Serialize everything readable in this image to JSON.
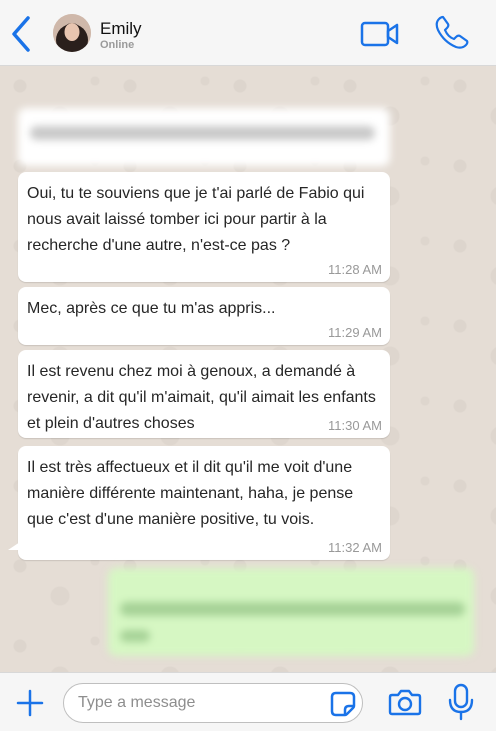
{
  "header": {
    "contact_name": "Emily",
    "status": "Online"
  },
  "messages": [
    {
      "text": "Oui, tu te souviens que je t'ai parlé de Fabio qui nous avait laissé tomber ici pour partir à la recherche d'une autre, n'est-ce pas ?",
      "time": "11:28 AM"
    },
    {
      "text": "Mec, après ce que tu m'as appris...",
      "time": "11:29 AM"
    },
    {
      "text": "Il est revenu chez moi à genoux, a demandé à revenir, a dit qu'il m'aimait, qu'il aimait les enfants et plein d'autres choses",
      "time": "11:30 AM"
    },
    {
      "text": "Il est très affectueux et il dit qu'il me voit d'une manière différente maintenant, haha, je pense que c'est d'une manière positive, tu vois.",
      "time": "11:32 AM"
    }
  ],
  "input": {
    "placeholder": "Type a message"
  },
  "icons": {
    "back": "chevron-left-icon",
    "video": "video-camera-icon",
    "call": "phone-icon",
    "add": "plus-icon",
    "sticker": "sticker-icon",
    "camera": "camera-icon",
    "mic": "microphone-icon"
  },
  "colors": {
    "accent": "#1a73e8",
    "chat_background": "#e5ddd5",
    "incoming_bubble": "#ffffff",
    "outgoing_bubble": "#d6f7c3",
    "header_background": "#f6f6f6"
  }
}
